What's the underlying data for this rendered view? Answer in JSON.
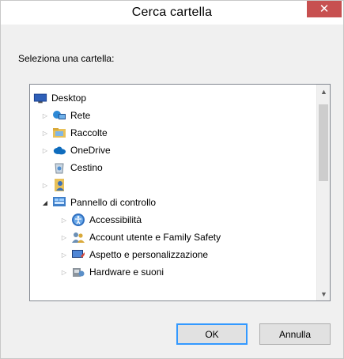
{
  "window": {
    "title": "Cerca cartella",
    "close_label": "✕"
  },
  "prompt": "Seleziona una cartella:",
  "tree": {
    "items": [
      {
        "label": "Desktop",
        "icon": "desktop-icon",
        "expander": "none"
      },
      {
        "label": "Rete",
        "icon": "network-icon",
        "expander": "collapsed"
      },
      {
        "label": "Raccolte",
        "icon": "libraries-icon",
        "expander": "collapsed"
      },
      {
        "label": "OneDrive",
        "icon": "onedrive-icon",
        "expander": "collapsed"
      },
      {
        "label": "Cestino",
        "icon": "recycle-bin-icon",
        "expander": "none"
      },
      {
        "label": "",
        "icon": "user-folder-icon",
        "expander": "collapsed"
      },
      {
        "label": "Pannello di controllo",
        "icon": "control-panel-icon",
        "expander": "expanded"
      },
      {
        "label": "Accessibilità",
        "icon": "accessibility-icon",
        "expander": "collapsed"
      },
      {
        "label": "Account utente e Family Safety",
        "icon": "user-accounts-icon",
        "expander": "collapsed"
      },
      {
        "label": "Aspetto e personalizzazione",
        "icon": "appearance-icon",
        "expander": "collapsed"
      },
      {
        "label": "Hardware e suoni",
        "icon": "hardware-sound-icon",
        "expander": "collapsed"
      }
    ]
  },
  "buttons": {
    "ok": "OK",
    "cancel": "Annulla"
  },
  "colors": {
    "close_bg": "#c75050",
    "focus_border": "#3399ff",
    "onedrive": "#0f6cbd"
  }
}
